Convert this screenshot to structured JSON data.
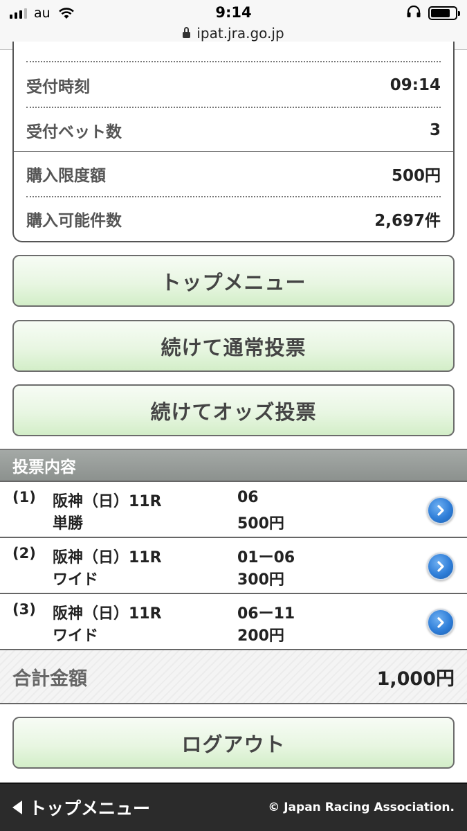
{
  "status_bar": {
    "carrier": "au",
    "time": "9:14",
    "url": "ipat.jra.go.jp",
    "battery_level": 0.8
  },
  "summary": {
    "rows": [
      {
        "label": "受付時刻",
        "value": "09:14"
      },
      {
        "label": "受付ベット数",
        "value": "3"
      },
      {
        "label": "購入限度額",
        "value": "500円"
      },
      {
        "label": "購入可能件数",
        "value": "2,697件"
      }
    ]
  },
  "buttons": {
    "top_menu": "トップメニュー",
    "continue_normal": "続けて通常投票",
    "continue_odds": "続けてオッズ投票",
    "logout": "ログアウト"
  },
  "bet_section": {
    "title": "投票内容",
    "bets": [
      {
        "num": "(1)",
        "race": "阪神（日）11R",
        "type": "単勝",
        "combo": "06",
        "amount": "500円"
      },
      {
        "num": "(2)",
        "race": "阪神（日）11R",
        "type": "ワイド",
        "combo": "01ー06",
        "amount": "300円"
      },
      {
        "num": "(3)",
        "race": "阪神（日）11R",
        "type": "ワイド",
        "combo": "06ー11",
        "amount": "200円"
      }
    ]
  },
  "total": {
    "label": "合計金額",
    "value": "1,000円"
  },
  "footer": {
    "back_label": "トップメニュー",
    "copyright": "© Japan Racing Association."
  }
}
